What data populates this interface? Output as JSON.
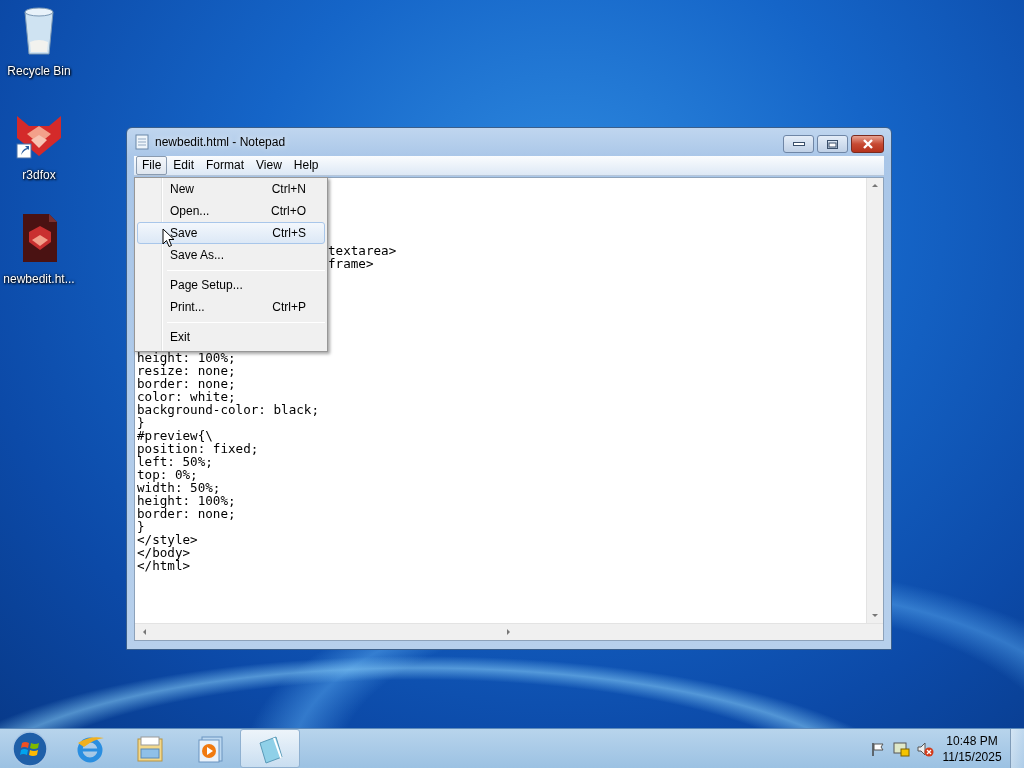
{
  "desktop_icons": [
    {
      "label": "Recycle Bin",
      "kind": "recycle"
    },
    {
      "label": "r3dfox",
      "kind": "shortcut"
    },
    {
      "label": "newbedit.ht...",
      "kind": "document"
    }
  ],
  "window": {
    "title": "newbedit.html - Notepad",
    "menu": [
      {
        "label": "File",
        "selected": true
      },
      {
        "label": "Edit",
        "selected": false
      },
      {
        "label": "Format",
        "selected": false
      },
      {
        "label": "View",
        "selected": false
      },
      {
        "label": "Help",
        "selected": false
      }
    ],
    "file_menu": [
      {
        "kind": "item",
        "label": "New",
        "shortcut": "Ctrl+N",
        "selected": false
      },
      {
        "kind": "item",
        "label": "Open...",
        "shortcut": "Ctrl+O",
        "selected": false
      },
      {
        "kind": "item",
        "label": "Save",
        "shortcut": "Ctrl+S",
        "selected": true
      },
      {
        "kind": "item",
        "label": "Save As...",
        "selected": false
      },
      {
        "kind": "separator"
      },
      {
        "kind": "item",
        "label": "Page Setup...",
        "selected": false
      },
      {
        "kind": "item",
        "label": "Print...",
        "shortcut": "Ctrl+P",
        "selected": false
      },
      {
        "kind": "separator"
      },
      {
        "kind": "item",
        "label": "Exit",
        "selected": false
      }
    ],
    "editor": {
      "fragments": [
        "textarea>",
        "frame>"
      ],
      "lines": [
        "height: 100%;",
        "resize: none;",
        "border: none;",
        "color: white;",
        "background-color: black;",
        "}",
        "#preview{\\",
        "position: fixed;",
        "left: 50%;",
        "top: 0%;",
        "width: 50%;",
        "height: 100%;",
        "border: none;",
        "}",
        "</style>",
        "</body>",
        "</html>"
      ]
    }
  },
  "taskbar": {
    "buttons": [
      {
        "kind": "browser",
        "selected": false
      },
      {
        "kind": "folder",
        "selected": false
      },
      {
        "kind": "media",
        "selected": false
      },
      {
        "kind": "notepad",
        "selected": true
      }
    ],
    "volume": {
      "muted": true
    },
    "clock": {
      "time": "10:48 PM",
      "date": "11/15/2025"
    }
  }
}
